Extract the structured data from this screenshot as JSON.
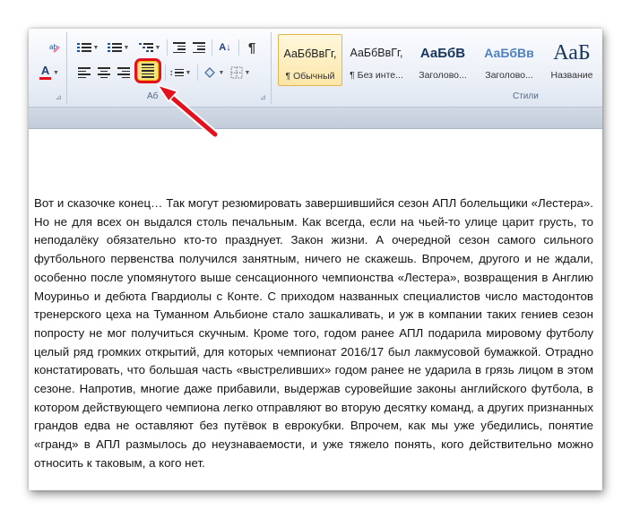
{
  "ribbon": {
    "paragraph_group_label": "Абзац",
    "paragraph_group_label_visible": "Аб",
    "pilcrow_glyph": "¶",
    "sort_glyph": "A↓",
    "styles_label": "Стили",
    "styles": [
      {
        "sample": "АаБбВвГг,",
        "name": "¶ Обычный"
      },
      {
        "sample": "АаБбВвГг,",
        "name": "¶ Без инте..."
      },
      {
        "sample": "АаБбВ",
        "name": "Заголово..."
      },
      {
        "sample": "АаБбВв",
        "name": "Заголово..."
      },
      {
        "sample": "АаБ",
        "name": "Название"
      }
    ],
    "font_color_glyph": "A",
    "colors": {
      "highlight_ring": "#e3101d",
      "arrow": "#e3101d",
      "font_color_bar": "#e3101d",
      "heading_blue": "#17365d"
    }
  },
  "document": {
    "paragraph": "Вот и сказочке конец… Так могут резюмировать завершившийся сезон АПЛ болельщики «Лестера». Но не для всех он выдался столь печальным. Как всегда, если на чьей-то улице царит грусть, то неподалёку обязательно кто-то празднует. Закон жизни. А очередной сезон самого сильного футбольного первенства получился занятным, ничего не скажешь. Впрочем, другого и не ждали, особенно после упомянутого выше сенсационного чемпионства «Лестера», возвращения в Англию Моуриньо и дебюта Гвардиолы с Конте. С приходом названных специалистов число мастодонтов тренерского цеха на Туманном Альбионе стало зашкаливать, и уж в компании таких гениев сезон попросту не мог получиться скучным. Кроме того, годом ранее АПЛ подарила мировому футболу целый ряд громких открытий, для которых чемпионат 2016/17 был лакмусовой бумажкой. Отрадно констатировать, что большая часть «выстреливших» годом ранее не ударила в грязь лицом в этом сезоне. Напротив, многие даже прибавили, выдержав суровейшие законы английского футбола, в котором действующего чемпиона легко отправляют во вторую десятку команд, а других признанных грандов едва не оставляют без путёвок в еврокубки. Впрочем, как мы уже убедились, понятие «гранд» в АПЛ размылось до неузнаваемости, и уже тяжело понять, кого действительно можно относить к таковым, а кого нет."
  }
}
